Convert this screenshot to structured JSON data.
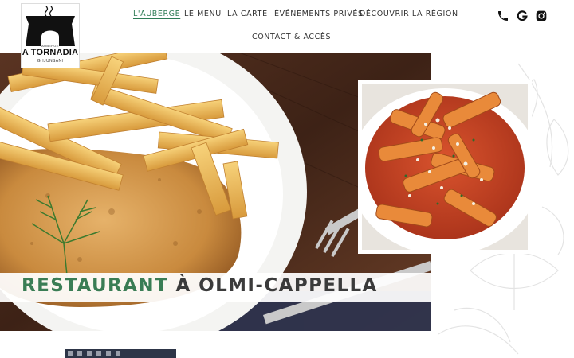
{
  "logo": {
    "top_text": "AUBERGE",
    "name": "A TORNADIA",
    "subtitle": "GHJUNSANI"
  },
  "nav": {
    "items": [
      {
        "label": "L'AUBERGE",
        "active": true
      },
      {
        "label": "LE MENU",
        "active": false
      },
      {
        "label": "LA CARTE",
        "active": false
      },
      {
        "label": "ÉVÉNEMENTS PRIVÉS",
        "active": false
      },
      {
        "label": "DÉCOUVRIR LA RÉGION",
        "active": false
      },
      {
        "label": "CONTACT & ACCÈS",
        "active": false
      }
    ]
  },
  "social": {
    "icons": [
      "phone-icon",
      "google-icon",
      "instagram-icon"
    ]
  },
  "hero": {
    "title_part1": "RESTAURANT",
    "title_part2": "À OLMI-CAPPELLA"
  },
  "colors": {
    "accent": "#3a7d55",
    "nav_active": "#2f7d56",
    "text_dark": "#3b3b3b"
  }
}
